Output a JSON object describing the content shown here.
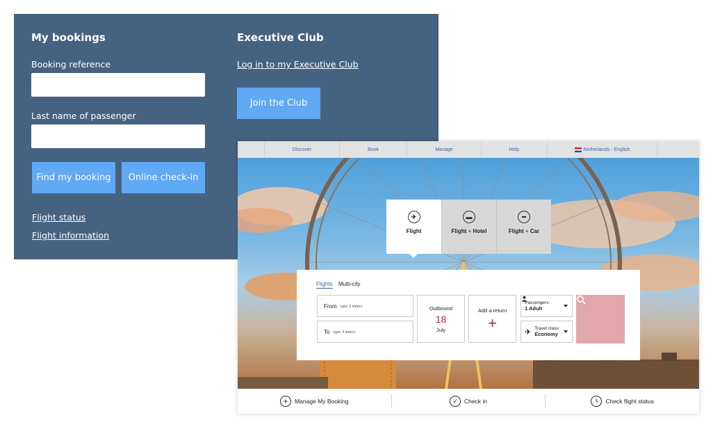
{
  "bookings": {
    "title": "My bookings",
    "ref_label": "Booking reference",
    "ref_value": "",
    "lastname_label": "Last name of passenger",
    "lastname_value": "",
    "find_button": "Find my booking",
    "checkin_button": "Online check-in",
    "link_status": "Flight status",
    "link_info": "Flight information"
  },
  "club": {
    "title": "Executive Club",
    "login_link": "Log in to my Executive Club",
    "join_button": "Join the Club"
  },
  "site": {
    "nav": [
      "Discover",
      "Book",
      "Manage",
      "Help",
      "Netherlands - English"
    ],
    "tabs": {
      "flight": "Flight",
      "flight_hotel_a": "Flight",
      "flight_hotel_plus": "+",
      "flight_hotel_b": "Hotel",
      "flight_car_a": "Flight",
      "flight_car_plus": "+",
      "flight_car_b": "Car"
    },
    "search": {
      "mode_flights": "Flights",
      "mode_multicity": "Multi-city",
      "from_label": "From",
      "from_hint": "type 3 letters",
      "to_label": "To",
      "to_hint": "type 3 letters",
      "outbound_label": "Outbound",
      "outbound_day": "18",
      "outbound_month": "July",
      "return_label": "Add a return",
      "passengers_label": "Passengers:",
      "passengers_value": "1 Adult",
      "class_label": "Travel class:",
      "class_value": "Economy"
    },
    "bottom": {
      "manage": "Manage My Booking",
      "checkin": "Check in",
      "status": "Check flight status"
    }
  },
  "colors": {
    "panel_bg": "#466281",
    "button_blue": "#60a9f5",
    "accent_red": "#b4272f",
    "link_blue": "#3d62a8",
    "search_button": "#e2a7aa"
  }
}
